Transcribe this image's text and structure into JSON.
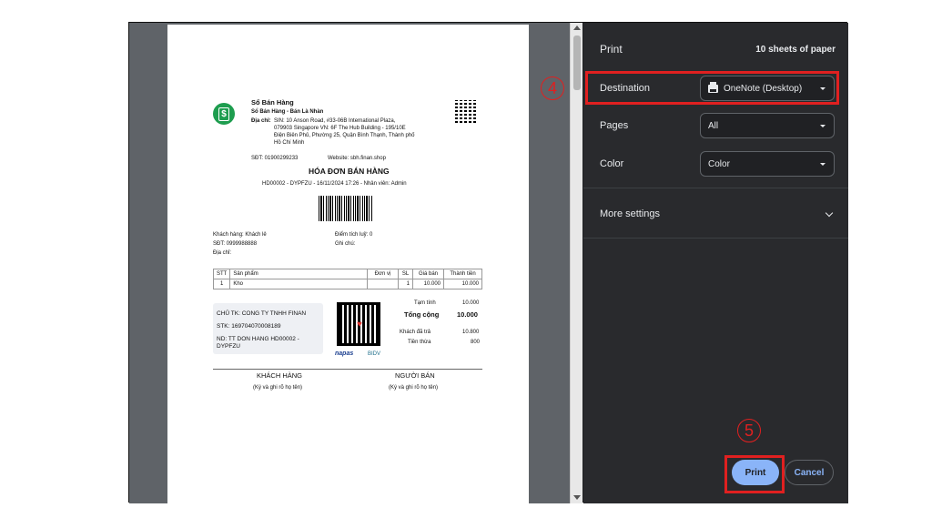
{
  "dialog": {
    "title": "Print",
    "sheets": "10 sheets of paper",
    "destination": {
      "label": "Destination",
      "value": "OneNote (Desktop)",
      "icon": "printer-icon"
    },
    "pages": {
      "label": "Pages",
      "value": "All"
    },
    "color": {
      "label": "Color",
      "value": "Color"
    },
    "more_settings": "More settings",
    "print_button": "Print",
    "cancel_button": "Cancel"
  },
  "annotations": {
    "step4": "4",
    "step5": "5",
    "color": "#e02020"
  },
  "receipt": {
    "store_name": "Sổ Bán Hàng",
    "store_sub": "Sổ Bán Hàng - Bán Là Nhàn",
    "address_label": "Địa chỉ:",
    "address_lines": [
      "SIN: 10 Anson Road, #33-06B International Plaza,",
      "079903 Singapore  VN: 6F The Hub Building - 195/10E",
      "Điện Biên Phủ, Phường 25, Quận Bình Thạnh, Thành phố",
      "Hồ Chí Minh"
    ],
    "phone": "SĐT: 01900299233",
    "website": "Website: sbh.finan.shop",
    "invoice_title": "HÓA ĐƠN BÁN HÀNG",
    "invoice_meta": "HD00002 - DYPFZU - 16/11/2024 17:26 - Nhân viên: Admin",
    "customer": "Khách hàng: Khách lẻ",
    "customer_phone": "SĐT: 0999988888",
    "customer_address": "Địa chỉ:",
    "points": "Điểm tích luỹ: 0",
    "note": "Ghi chú:",
    "table_headers": [
      "STT",
      "Sản phẩm",
      "Đơn vị",
      "SL",
      "Giá bán",
      "Thành tiền"
    ],
    "table_rows": [
      [
        "1",
        "Kho",
        "",
        "1",
        "10.000",
        "10.000"
      ]
    ],
    "subtotal_label": "Tạm tính",
    "subtotal": "10.000",
    "total_label": "Tổng cộng",
    "total": "10.000",
    "paid_label": "Khách đã trả",
    "paid": "10.800",
    "change_label": "Tiền thừa",
    "change": "800",
    "bank_owner": "CHỦ TK: CONG TY TNHH FINAN",
    "bank_account": "STK: 169704070008189",
    "bank_note": "ND: TT DON HANG HD00002 - DYPFZU",
    "napas": "napas",
    "bidv": "BIDV",
    "sign_customer": "KHÁCH HÀNG",
    "sign_customer_note": "(Ký và ghi rõ họ tên)",
    "sign_seller": "NGƯỜI BÁN",
    "sign_seller_note": "(Ký và ghi rõ họ tên)"
  }
}
